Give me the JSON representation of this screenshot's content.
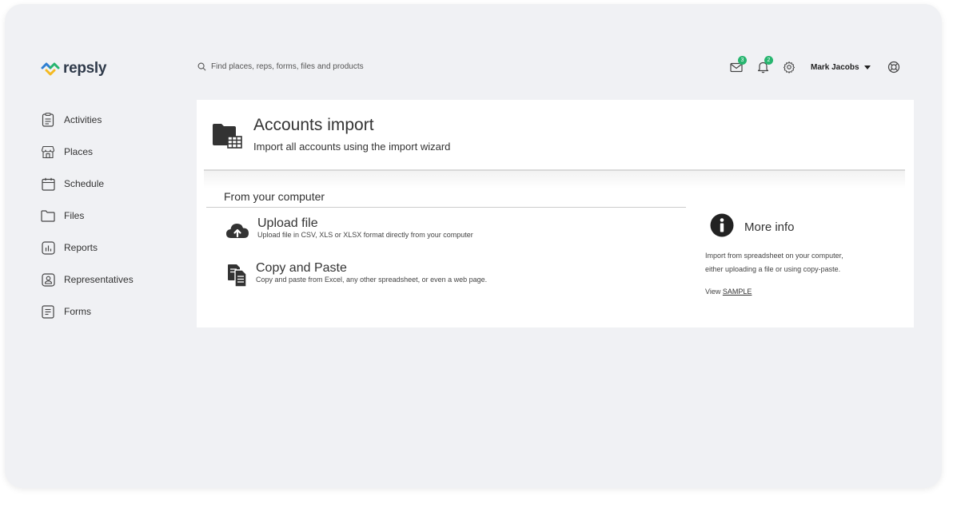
{
  "brand": {
    "name": "repsly",
    "colors": {
      "blue": "#2f7fd1",
      "green": "#27b56f",
      "yellow": "#f4b921"
    }
  },
  "search": {
    "placeholder": "Find places, reps, forms, files and products"
  },
  "header": {
    "messages_badge": "3",
    "notifications_badge": "2",
    "user_name": "Mark Jacobs"
  },
  "sidebar": {
    "items": [
      {
        "label": "Activities",
        "icon": "clipboard-icon"
      },
      {
        "label": "Places",
        "icon": "store-icon"
      },
      {
        "label": "Schedule",
        "icon": "calendar-icon"
      },
      {
        "label": "Files",
        "icon": "folder-icon"
      },
      {
        "label": "Reports",
        "icon": "chart-icon"
      },
      {
        "label": "Representatives",
        "icon": "person-icon"
      },
      {
        "label": "Forms",
        "icon": "form-icon"
      }
    ]
  },
  "main": {
    "title": "Accounts import",
    "subtitle": "Import all accounts using the import wizard",
    "section_title": "From your computer",
    "options": [
      {
        "title": "Upload file",
        "description": "Upload file in CSV, XLS or XLSX format directly from your computer",
        "icon": "cloud-upload-icon"
      },
      {
        "title": "Copy and Paste",
        "description": "Copy and paste from Excel, any other spreadsheet, or even a web page.",
        "icon": "copy-paste-icon"
      }
    ],
    "info": {
      "title": "More info",
      "text_line1": "Import from spreadsheet on your computer,",
      "text_line2": "either uploading a file or using copy-paste.",
      "view_prefix": "View",
      "view_link": "SAMPLE"
    }
  }
}
